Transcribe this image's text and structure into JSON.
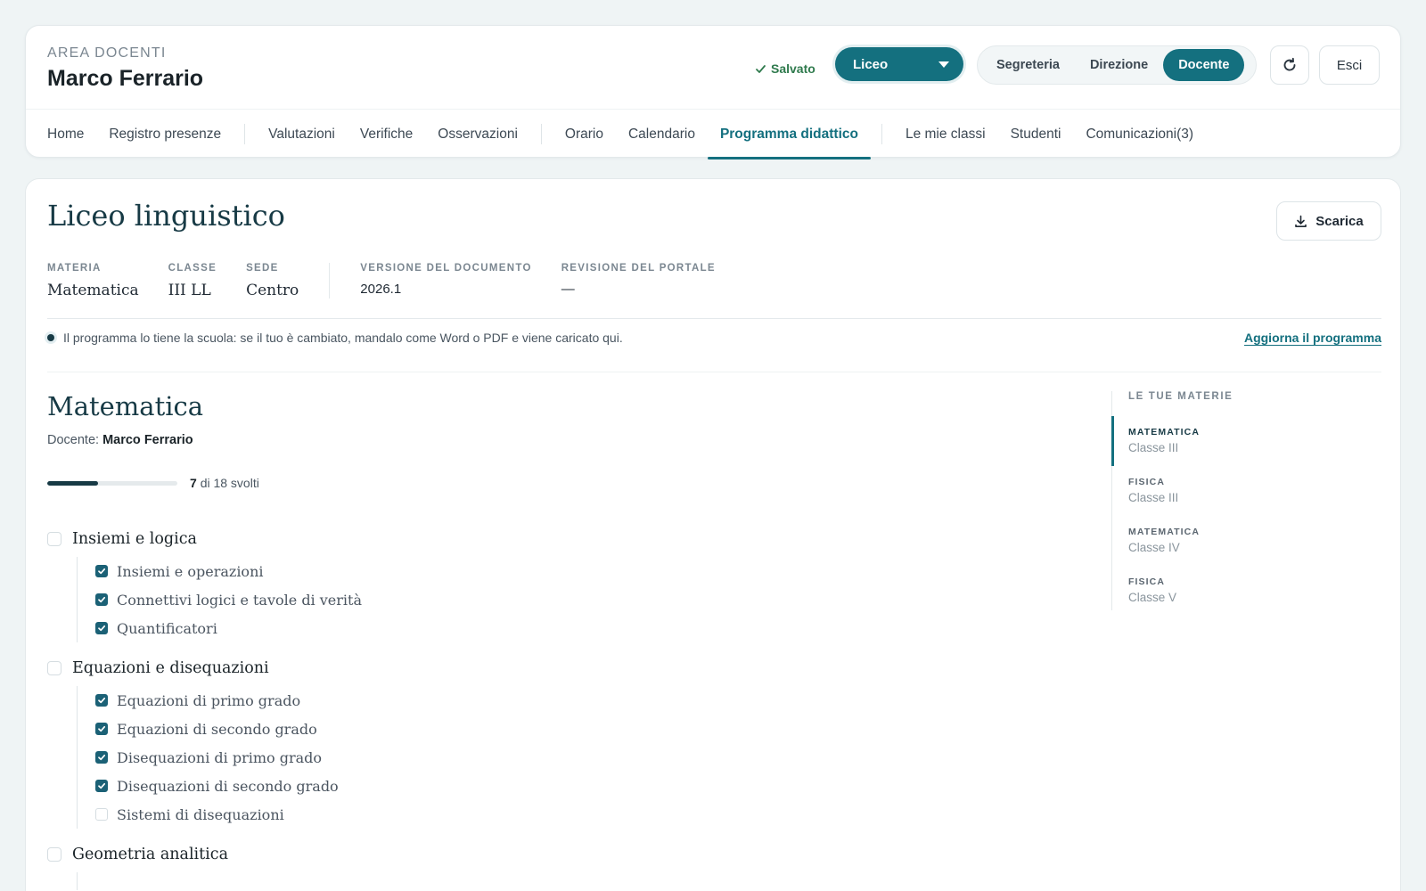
{
  "header": {
    "area_label": "AREA DOCENTI",
    "user_name": "Marco Ferrario",
    "saved_label": "Salvato",
    "school_select": "Liceo",
    "roles": [
      {
        "label": "Segreteria",
        "active": false
      },
      {
        "label": "Direzione",
        "active": false
      },
      {
        "label": "Docente",
        "active": true
      }
    ],
    "exit_label": "Esci"
  },
  "nav": {
    "items": [
      {
        "label": "Home"
      },
      {
        "label": "Registro presenze"
      },
      {
        "label": "Valutazioni"
      },
      {
        "label": "Verifiche"
      },
      {
        "label": "Osservazioni"
      },
      {
        "label": "Orario"
      },
      {
        "label": "Calendario"
      },
      {
        "label": "Programma didattico",
        "active": true
      },
      {
        "label": "Le mie classi"
      },
      {
        "label": "Studenti"
      },
      {
        "label": "Comunicazioni(3)"
      }
    ]
  },
  "document": {
    "title": "Liceo linguistico",
    "download_label": "Scarica",
    "meta": {
      "materia_label": "MATERIA",
      "materia": "Matematica",
      "classe_label": "CLASSE",
      "classe": "III LL",
      "sede_label": "SEDE",
      "sede": "Centro",
      "versione_label": "VERSIONE DEL DOCUMENTO",
      "versione": "2026.1",
      "revisione_label": "REVISIONE DEL PORTALE",
      "revisione": "—"
    },
    "info_text": "Il programma lo tiene la scuola: se il tuo è cambiato, mandalo come Word o PDF e viene caricato qui.",
    "update_link": "Aggiorna il programma"
  },
  "subject": {
    "title": "Matematica",
    "teacher_prefix": "Docente:",
    "teacher_name": "Marco Ferrario",
    "progress_done": "7",
    "progress_suffix": "di 18 svolti",
    "progress_fraction": 0.3889
  },
  "topics": [
    {
      "label": "Insiemi e logica",
      "checked": false,
      "subtopics": [
        {
          "label": "Insiemi e operazioni",
          "checked": true
        },
        {
          "label": "Connettivi logici e tavole di verità",
          "checked": true
        },
        {
          "label": "Quantificatori",
          "checked": true
        }
      ]
    },
    {
      "label": "Equazioni e disequazioni",
      "checked": false,
      "subtopics": [
        {
          "label": "Equazioni di primo grado",
          "checked": true
        },
        {
          "label": "Equazioni di secondo grado",
          "checked": true
        },
        {
          "label": "Disequazioni di primo grado",
          "checked": true
        },
        {
          "label": "Disequazioni di secondo grado",
          "checked": true
        },
        {
          "label": "Sistemi di disequazioni",
          "checked": false
        }
      ]
    },
    {
      "label": "Geometria analitica",
      "checked": false,
      "subtopics": []
    }
  ],
  "side": {
    "title": "LE TUE MATERIE",
    "items": [
      {
        "subject": "MATEMATICA",
        "class": "Classe III",
        "active": true
      },
      {
        "subject": "FISICA",
        "class": "Classe III",
        "active": false
      },
      {
        "subject": "MATEMATICA",
        "class": "Classe IV",
        "active": false
      },
      {
        "subject": "FISICA",
        "class": "Classe V",
        "active": false
      }
    ]
  },
  "colors": {
    "accent": "#14707f",
    "dark": "#173a45",
    "checkbox_checked": "#1b6176",
    "saved_green": "#2f7a4d",
    "background": "#eff4f5"
  }
}
